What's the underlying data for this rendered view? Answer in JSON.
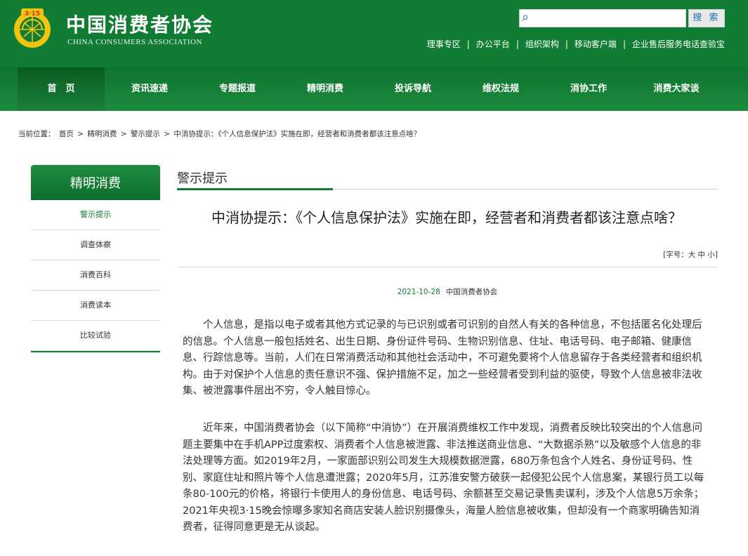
{
  "header": {
    "title_cn": "中国消费者协会",
    "title_en": "CHINA CONSUMERS ASSOCIATION",
    "search_button": "搜 索",
    "links": [
      "理事专区",
      "办公平台",
      "组织架构",
      "移动客户端",
      "企业售后服务电话查验宝"
    ],
    "separator": "|"
  },
  "nav": {
    "items": [
      "首　页",
      "资讯速递",
      "专题报道",
      "精明消费",
      "投诉导航",
      "维权法规",
      "消协工作",
      "消费大家谈"
    ]
  },
  "breadcrumb": {
    "prefix": "当前位置：",
    "items": [
      "首页",
      "精明消费",
      "警示提示",
      "中消协提示：《个人信息保护法》实施在即，经营者和消费者都该注意点啥？"
    ],
    "separator": ">"
  },
  "sidebar": {
    "title": "精明消费",
    "items": [
      "警示提示",
      "调查体察",
      "消费百科",
      "消费读本",
      "比较试验"
    ]
  },
  "main": {
    "section_title": "警示提示",
    "article_title": "中消协提示：《个人信息保护法》实施在即，经营者和消费者都该注意点啥？",
    "font_size_label": "[字号：",
    "font_size_large": "大",
    "font_size_medium": "中",
    "font_size_small": "小",
    "font_size_end": "]",
    "date": "2021-10-28",
    "source": "中国消费者协会",
    "paragraphs": [
      "个人信息，是指以电子或者其他方式记录的与已识别或者可识别的自然人有关的各种信息，不包括匿名化处理后的信息。个人信息一般包括姓名、出生日期、身份证件号码、生物识别信息、住址、电话号码、电子邮箱、健康信息、行踪信息等。当前，人们在日常消费活动和其他社会活动中，不可避免要将个人信息留存于各类经营者和组织机构。由于对保护个人信息的责任意识不强、保护措施不足，加之一些经营者受到利益的驱使，导致个人信息被非法收集、被泄露事件层出不穷，令人触目惊心。",
      "近年来，中国消费者协会（以下简称“中消协”）在开展消费维权工作中发现，消费者反映比较突出的个人信息问题主要集中在手机APP过度索权、消费者个人信息被泄露、非法推送商业信息、“大数据杀熟”以及敏感个人信息的非法处理等方面。如2019年2月，一家面部识别公司发生大规模数据泄露，680万条包含个人姓名、身份证号码、性别、家庭住址和照片等个人信息遭泄露；2020年5月，江苏淮安警方破获一起侵犯公民个人信息案，某银行员工以每条80-100元的价格，将银行卡使用人的身份信息、电话号码、余额甚至交易记录售卖谋利，涉及个人信息5万余条；2021年央视3·15晚会惊曝多家知名商店安装人脸识别摄像头，海量人脸信息被收集，但却没有一个商家明确告知消费者，征得同意更是无从谈起。"
    ]
  }
}
